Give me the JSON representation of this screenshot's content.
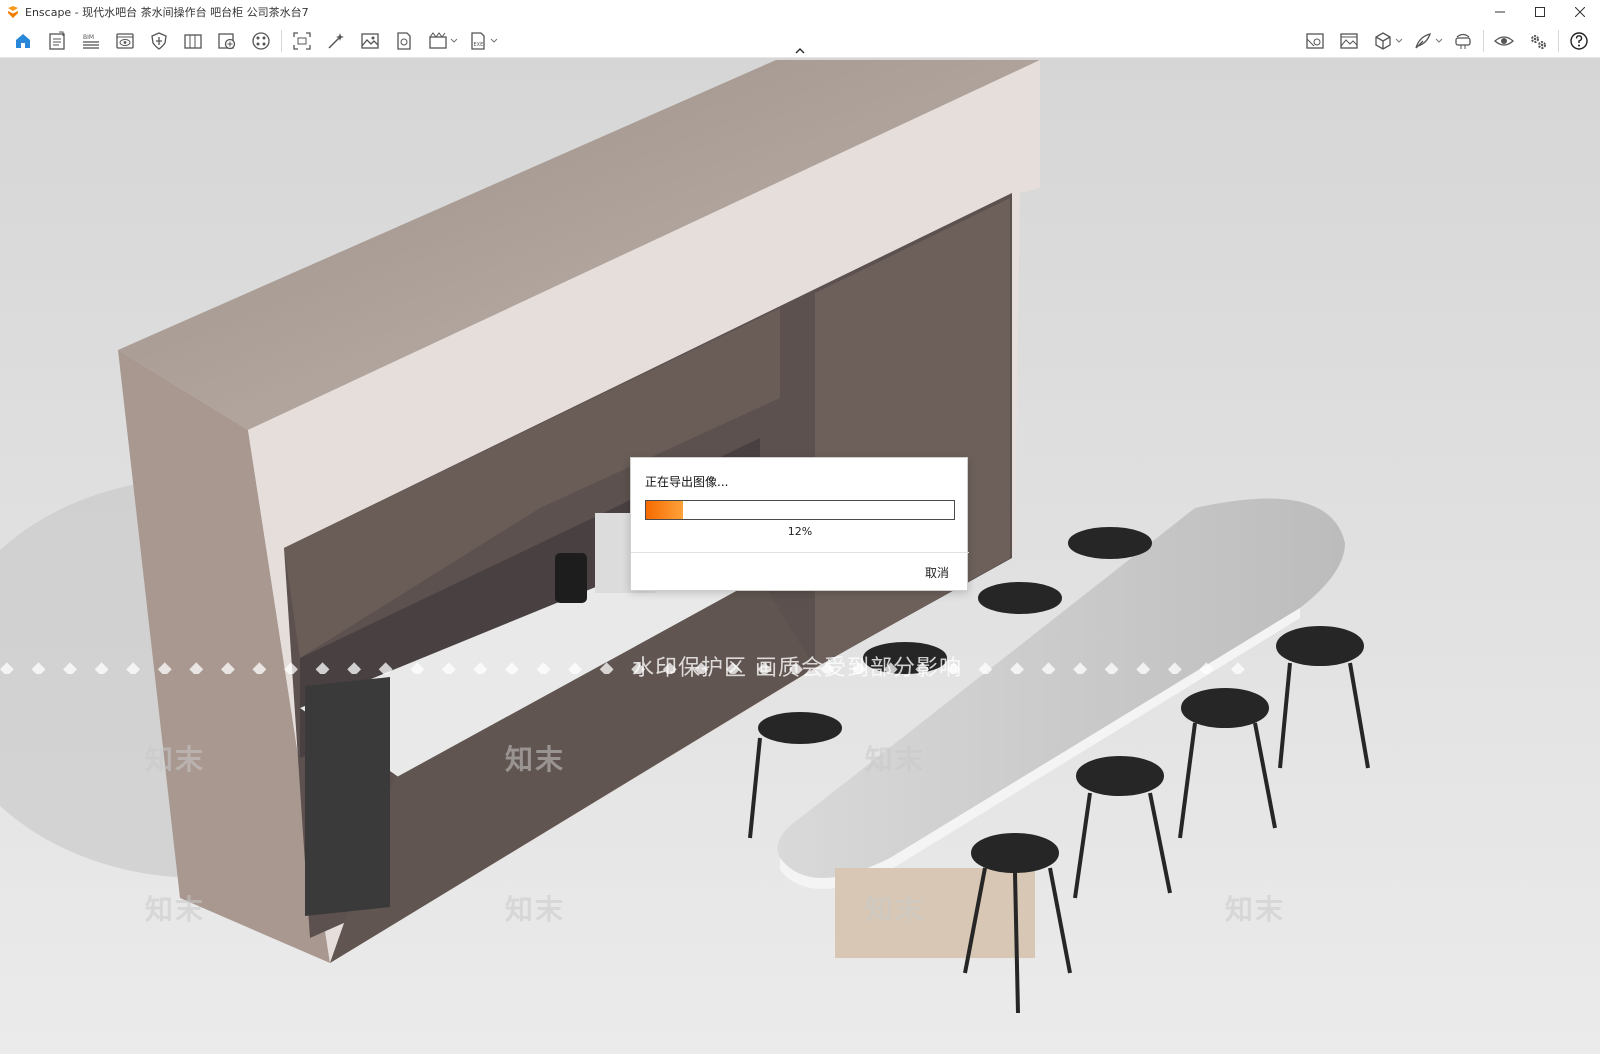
{
  "window": {
    "title": "Enscape - 现代水吧台 茶水间操作台 吧台柜 公司茶水台7",
    "controls": [
      "minimize-icon",
      "maximize-icon",
      "close-icon"
    ]
  },
  "toolbar": {
    "left_groups": [
      [
        "home-icon",
        "document-icon",
        "bim-icon",
        "view-icon",
        "shield-icon",
        "library-icon",
        "asset-icon",
        "palette-icon"
      ],
      [
        "screenshot-icon",
        "magic-wand-icon",
        "image-icon",
        "render-icon",
        "batch-icon",
        "export-icon"
      ]
    ],
    "bim_label": "BIM",
    "exe_label": "EXE",
    "right_icons": [
      "map-icon",
      "gallery-icon",
      "cube-icon",
      "feather-icon",
      "vr-headset-icon",
      "eye-icon",
      "settings-icon",
      "help-icon"
    ],
    "accent_color": "#2a88d8"
  },
  "watermark": {
    "text": "水印保护区   画质会受到部分影响",
    "logo": "知末"
  },
  "dialog": {
    "title": "正在导出图像...",
    "progress_percent": 12,
    "progress_label": "12%",
    "cancel_label": "取消"
  }
}
